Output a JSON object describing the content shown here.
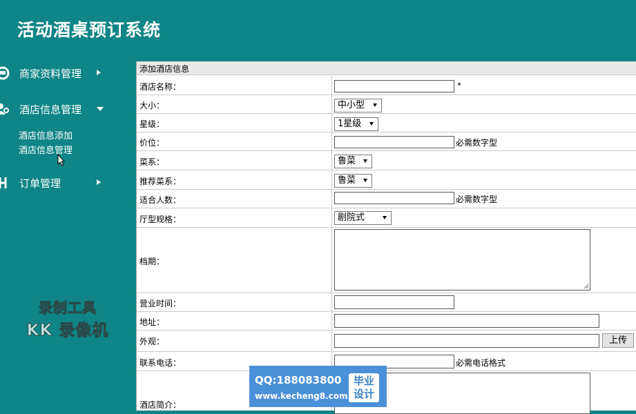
{
  "app": {
    "title": "活动酒桌预订系统"
  },
  "sidebar": {
    "menus": [
      {
        "label": "商家资料管理",
        "icon": "merchant-icon"
      },
      {
        "label": "酒店信息管理",
        "icon": "users-icon",
        "expanded": true,
        "items": [
          "酒店信息添加",
          "酒店信息管理"
        ]
      },
      {
        "label": "订单管理",
        "icon": "order-icon"
      }
    ]
  },
  "watermark": {
    "line1": "录制工具",
    "line2": "KK 录像机"
  },
  "form": {
    "header": "添加酒店信息",
    "fields": {
      "name": {
        "label": "酒店名称：",
        "value": "",
        "required_mark": "*"
      },
      "size": {
        "label": "大小：",
        "value": "中小型"
      },
      "star": {
        "label": "星级：",
        "value": "1星级"
      },
      "price": {
        "label": "价位：",
        "value": "",
        "hint": "必需数字型"
      },
      "cuisine": {
        "label": "菜系：",
        "value": "鲁菜"
      },
      "recommended_cuisine": {
        "label": "推荐菜系：",
        "value": "鲁菜"
      },
      "capacity": {
        "label": "适合人数：",
        "value": "",
        "hint": "必需数字型"
      },
      "hall_type": {
        "label": "厅型规格：",
        "value": "剧院式"
      },
      "schedule": {
        "label": "档期：",
        "value": ""
      },
      "hours": {
        "label": "营业时间：",
        "value": ""
      },
      "address": {
        "label": "地址：",
        "value": ""
      },
      "appearance": {
        "label": "外观：",
        "value": "",
        "upload_label": "上传"
      },
      "phone": {
        "label": "联系电话：",
        "value": "",
        "hint": "必需电话格式"
      },
      "intro": {
        "label": "酒店简介：",
        "value": ""
      }
    }
  },
  "ad": {
    "qq": "QQ:188083800",
    "url": "www.kecheng8.com",
    "badge_line1": "毕业",
    "badge_line2": "设计"
  }
}
